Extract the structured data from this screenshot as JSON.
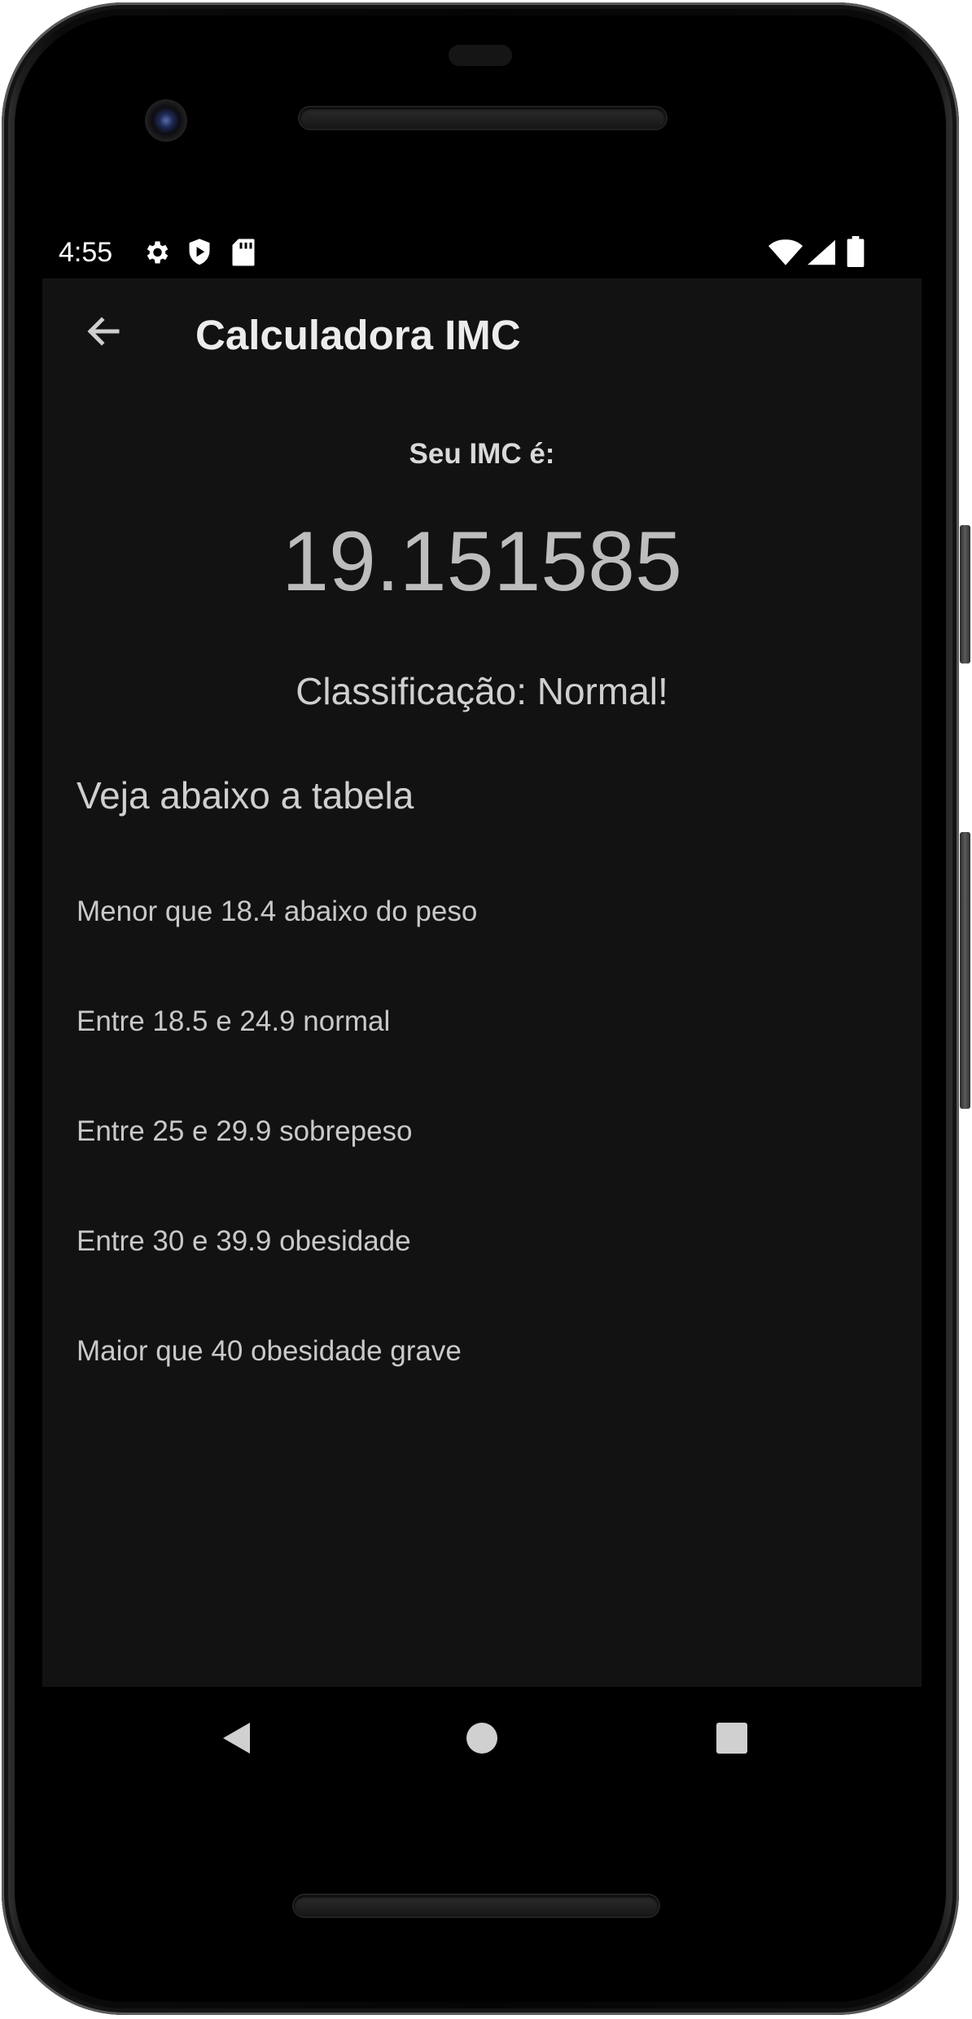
{
  "status_bar": {
    "time": "4:55",
    "icons": [
      "gear-icon",
      "shield-play-icon",
      "sd-card-icon",
      "wifi-icon",
      "cellular-signal-icon",
      "battery-icon"
    ]
  },
  "app_bar": {
    "title": "Calculadora IMC",
    "back_icon": "arrow-left-icon"
  },
  "result": {
    "label": "Seu IMC é:",
    "value": "19.151585",
    "classification": "Classificação: Normal!"
  },
  "table": {
    "heading": "Veja abaixo a tabela",
    "rows": [
      "Menor que 18.4 abaixo do peso",
      "Entre 18.5 e 24.9 normal",
      "Entre 25 e 29.9 sobrepeso",
      "Entre 30 e 39.9 obesidade",
      "Maior que 40 obesidade grave"
    ]
  },
  "nav_bar": {
    "icons": [
      "back-triangle-icon",
      "home-circle-icon",
      "recents-square-icon"
    ]
  },
  "colors": {
    "screen_background": "#121212",
    "text_primary": "#ececec",
    "text_secondary": "#cfcfcf",
    "phone_body": "#000000"
  }
}
